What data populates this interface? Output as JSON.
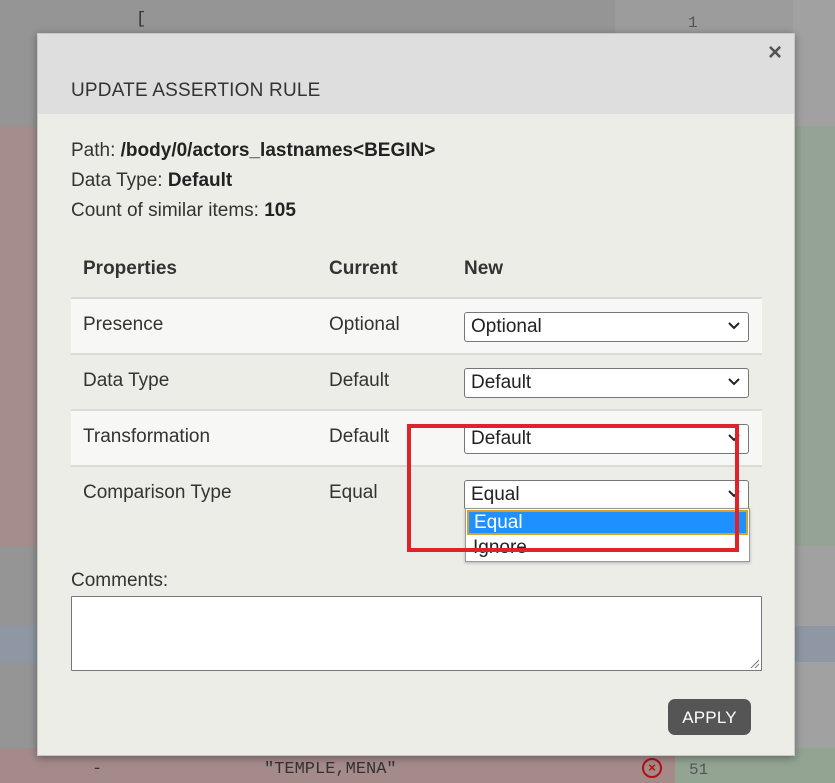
{
  "background": {
    "top_bracket": "[",
    "top_line_number": "1",
    "bottom_dash": "-",
    "bottom_value": "\"TEMPLE,MENA\"",
    "bottom_line_number": "51",
    "error_icon": "circle-x-icon"
  },
  "modal": {
    "title": "UPDATE ASSERTION RULE",
    "close_label": "×",
    "path_label": "Path:",
    "path_value": "/body/0/actors_lastnames<BEGIN>",
    "data_type_label": "Data Type:",
    "data_type_value": "Default",
    "count_label": "Count of similar items:",
    "count_value": "105",
    "table": {
      "headers": {
        "properties": "Properties",
        "current": "Current",
        "new": "New"
      },
      "rows": [
        {
          "property": "Presence",
          "current": "Optional",
          "new": "Optional"
        },
        {
          "property": "Data Type",
          "current": "Default",
          "new": "Default"
        },
        {
          "property": "Transformation",
          "current": "Default",
          "new": "Default"
        },
        {
          "property": "Comparison Type",
          "current": "Equal",
          "new": "Equal"
        }
      ]
    },
    "dropdown_options": [
      "Equal",
      "Ignore"
    ],
    "dropdown_selected": "Equal",
    "comments_label": "Comments:",
    "comments_value": "",
    "apply_label": "APPLY"
  },
  "colors": {
    "highlight": "#e0222a",
    "option_highlight": "#1e90ff",
    "apply_button": "#555555"
  }
}
